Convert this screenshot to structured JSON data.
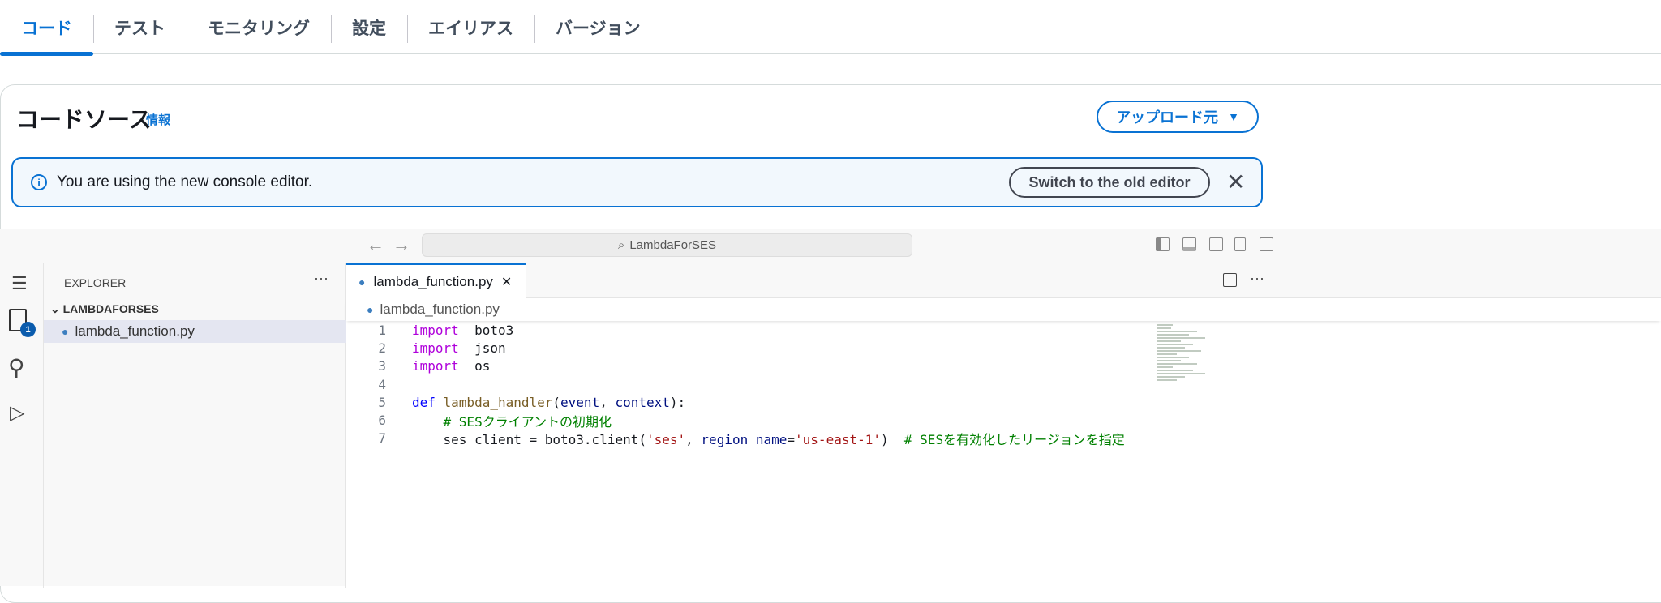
{
  "tabs": [
    "コード",
    "テスト",
    "モニタリング",
    "設定",
    "エイリアス",
    "バージョン"
  ],
  "section": {
    "title": "コードソース",
    "info": "情報",
    "upload": "アップロード元",
    "upload_caret": "▼"
  },
  "alert": {
    "message": "You are using the new console editor.",
    "switch_button": "Switch to the old editor",
    "close": "✕"
  },
  "ide": {
    "search": "LambdaForSES",
    "explorer_title": "EXPLORER",
    "folder": "LAMBDAFORSES",
    "file": "lambda_function.py",
    "badge": "1",
    "tab": "lambda_function.py",
    "breadcrumb": "lambda_function.py",
    "code": [
      {
        "n": "1",
        "t": [
          [
            "kw",
            "import"
          ],
          [
            "",
            "  boto3"
          ]
        ]
      },
      {
        "n": "2",
        "t": [
          [
            "kw",
            "import"
          ],
          [
            "",
            "  json"
          ]
        ]
      },
      {
        "n": "3",
        "t": [
          [
            "kw",
            "import"
          ],
          [
            "",
            "  os"
          ]
        ]
      },
      {
        "n": "4",
        "t": []
      },
      {
        "n": "5",
        "t": [
          [
            "def",
            "def "
          ],
          [
            "fn",
            "lambda_handler"
          ],
          [
            "",
            "("
          ],
          [
            "pa",
            "event"
          ],
          [
            "",
            ", "
          ],
          [
            "pa",
            "context"
          ],
          [
            "",
            "):"
          ]
        ]
      },
      {
        "n": "6",
        "t": [
          [
            "",
            "    "
          ],
          [
            "cm",
            "# SESクライアントの初期化"
          ]
        ]
      },
      {
        "n": "7",
        "t": [
          [
            "",
            "    ses_client = boto3.client("
          ],
          [
            "st",
            "'ses'"
          ],
          [
            "",
            ", "
          ],
          [
            "pa",
            "region_name"
          ],
          [
            "",
            "="
          ],
          [
            "st",
            "'us-east-1'"
          ],
          [
            "",
            ")  "
          ],
          [
            "cm",
            "# SESを有効化したリージョンを指定"
          ]
        ]
      }
    ]
  }
}
